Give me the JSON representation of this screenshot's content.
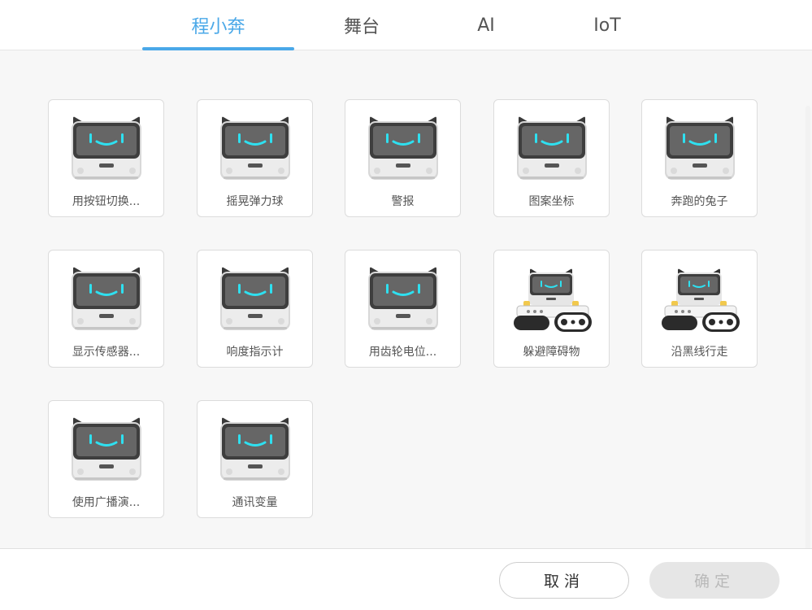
{
  "tabs": [
    {
      "label": "程小奔",
      "active": true
    },
    {
      "label": "舞台",
      "active": false
    },
    {
      "label": "AI",
      "active": false
    },
    {
      "label": "IoT",
      "active": false
    }
  ],
  "examples": [
    {
      "label": "用按钮切换...",
      "icon": "codey-robot-icon"
    },
    {
      "label": "摇晃弹力球",
      "icon": "codey-robot-icon"
    },
    {
      "label": "警报",
      "icon": "codey-robot-icon"
    },
    {
      "label": "图案坐标",
      "icon": "codey-robot-icon"
    },
    {
      "label": "奔跑的兔子",
      "icon": "codey-robot-icon"
    },
    {
      "label": "显示传感器...",
      "icon": "codey-robot-icon"
    },
    {
      "label": "响度指示计",
      "icon": "codey-robot-icon"
    },
    {
      "label": "用齿轮电位...",
      "icon": "codey-robot-icon"
    },
    {
      "label": "躲避障碍物",
      "icon": "codey-rocky-car-icon"
    },
    {
      "label": "沿黑线行走",
      "icon": "codey-rocky-car-icon"
    },
    {
      "label": "使用广播演...",
      "icon": "codey-robot-icon"
    },
    {
      "label": "通讯变量",
      "icon": "codey-robot-icon"
    }
  ],
  "footer": {
    "cancel_label": "取消",
    "confirm_label": "确定"
  },
  "colors": {
    "accent": "#4aa8e8",
    "eye": "#2ee0f0",
    "disabled_bg": "#e6e6e6"
  }
}
